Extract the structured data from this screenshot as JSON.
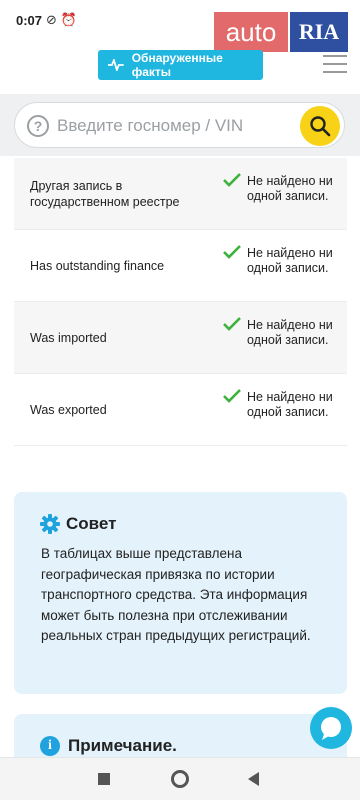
{
  "status_bar": {
    "time": "0:07",
    "icons": [
      "mute-icon",
      "alarm-icon",
      "wifi-icon",
      "battery-icon"
    ]
  },
  "logo": {
    "part1": "auto",
    "part2": "RIA"
  },
  "header": {
    "facts_button_label": "Обнаруженные факты"
  },
  "search": {
    "placeholder": "Введите госномер / VIN",
    "value": ""
  },
  "results": [
    {
      "label": "Другая запись в государственном реестре",
      "status": "Не найдено ни одной записи."
    },
    {
      "label": "Has outstanding finance",
      "status": "Не найдено ни одной записи."
    },
    {
      "label": "Was imported",
      "status": "Не найдено ни одной записи."
    },
    {
      "label": "Was exported",
      "status": "Не найдено ни одной записи."
    }
  ],
  "tip": {
    "title": "Совет",
    "text": "В таблицах выше представлена географическая привязка по истории транспортного средства. Эта информация может быть полезна при отслеживании реальных стран предыдущих регистраций."
  },
  "note": {
    "title": "Примечание."
  },
  "colors": {
    "accent": "#1fb6e0",
    "search_button": "#f7d217",
    "check": "#3cb13c",
    "card_bg": "#e4f3fb"
  }
}
